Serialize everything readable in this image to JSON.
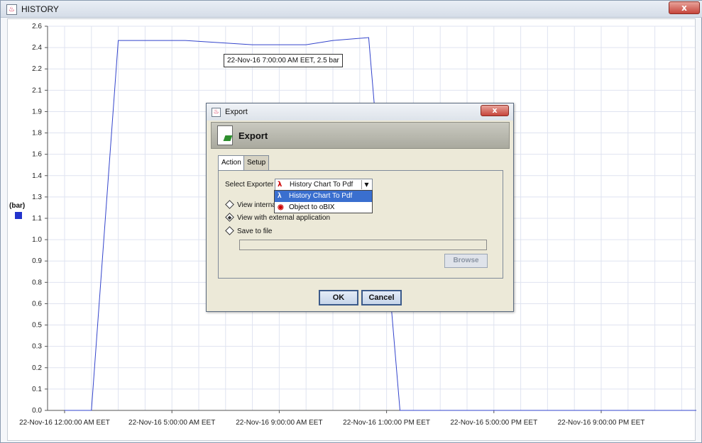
{
  "window": {
    "title": "HISTORY",
    "close_label": "x"
  },
  "chart_data": {
    "type": "line",
    "title": "",
    "ylabel": "(bar)",
    "xlabel": "",
    "ylim": [
      0.0,
      2.7
    ],
    "yticks": [
      "0.0",
      "0.1",
      "0.2",
      "0.3",
      "0.5",
      "0.6",
      "0.8",
      "0.9",
      "1.0",
      "1.1",
      "1.3",
      "1.4",
      "1.6",
      "1.8",
      "1.9",
      "2.1",
      "2.2",
      "2.4",
      "2.6"
    ],
    "xticks": [
      "22-Nov-16 12:00:00 AM EET",
      "22-Nov-16 5:00:00 AM EET",
      "22-Nov-16 9:00:00 AM EET",
      "22-Nov-16 1:00:00 PM EET",
      "22-Nov-16 5:00:00 PM EET",
      "22-Nov-16 9:00:00 PM EET"
    ],
    "series": [
      {
        "color": "#3344cc",
        "points": [
          [
            "22-Nov-16 12:00:00 AM",
            0.0
          ],
          [
            "22-Nov-16 1:00:00 AM",
            0.0
          ],
          [
            "22-Nov-16 2:00:00 AM",
            2.6
          ],
          [
            "22-Nov-16 4:30:00 AM",
            2.6
          ],
          [
            "22-Nov-16 7:00:00 AM",
            2.57
          ],
          [
            "22-Nov-16 9:00:00 AM",
            2.57
          ],
          [
            "22-Nov-16 10:00:00 AM",
            2.6
          ],
          [
            "22-Nov-16 11:20:00 AM",
            2.62
          ],
          [
            "22-Nov-16 12:30:00 PM",
            0.0
          ],
          [
            "22-Nov-16 11:59:00 PM",
            0.0
          ]
        ]
      }
    ],
    "tooltip": "22-Nov-16 7:00:00 AM EET, 2.5 bar",
    "grid": true
  },
  "dialog": {
    "title": "Export",
    "close_label": "x",
    "header": "Export",
    "tabs": [
      "Action",
      "Setup"
    ],
    "select_label": "Select Exporter",
    "select_value": "History Chart To Pdf",
    "options": [
      "History Chart To Pdf",
      "Object to oBIX"
    ],
    "radio_internal": "View interna",
    "radio_external": "View with external application",
    "radio_save": "Save to file",
    "browse_label": "Browse",
    "ok_label": "OK",
    "cancel_label": "Cancel"
  }
}
